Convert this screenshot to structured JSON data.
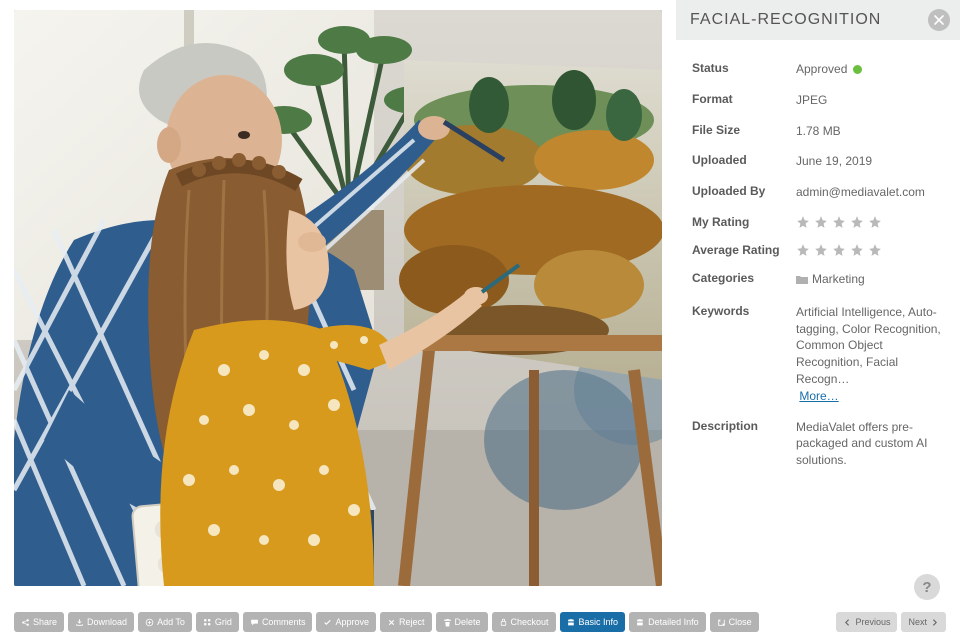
{
  "panel": {
    "title": "FACIAL-RECOGNITION",
    "fields": {
      "status_label": "Status",
      "status_value": "Approved",
      "format_label": "Format",
      "format_value": "JPEG",
      "filesize_label": "File Size",
      "filesize_value": "1.78 MB",
      "uploaded_label": "Uploaded",
      "uploaded_value": "June 19, 2019",
      "uploadedby_label": "Uploaded By",
      "uploadedby_value": "admin@mediavalet.com",
      "myrating_label": "My Rating",
      "avgrating_label": "Average Rating",
      "categories_label": "Categories",
      "categories_value": "Marketing",
      "keywords_label": "Keywords",
      "keywords_value": "Artificial Intelligence, Auto-tagging,  Color Recognition, Common Object Recognition, Facial Recogn…",
      "keywords_more": "More…",
      "description_label": "Description",
      "description_value": "MediaValet offers pre-packaged and custom AI solutions."
    }
  },
  "toolbar": {
    "share": "Share",
    "download": "Download",
    "addto": "Add To",
    "grid": "Grid",
    "comments": "Comments",
    "approve": "Approve",
    "reject": "Reject",
    "delete": "Delete",
    "checkout": "Checkout",
    "basic": "Basic Info",
    "detailed": "Detailed Info",
    "close": "Close"
  },
  "nav": {
    "prev": "Previous",
    "next": "Next"
  },
  "help": "?"
}
